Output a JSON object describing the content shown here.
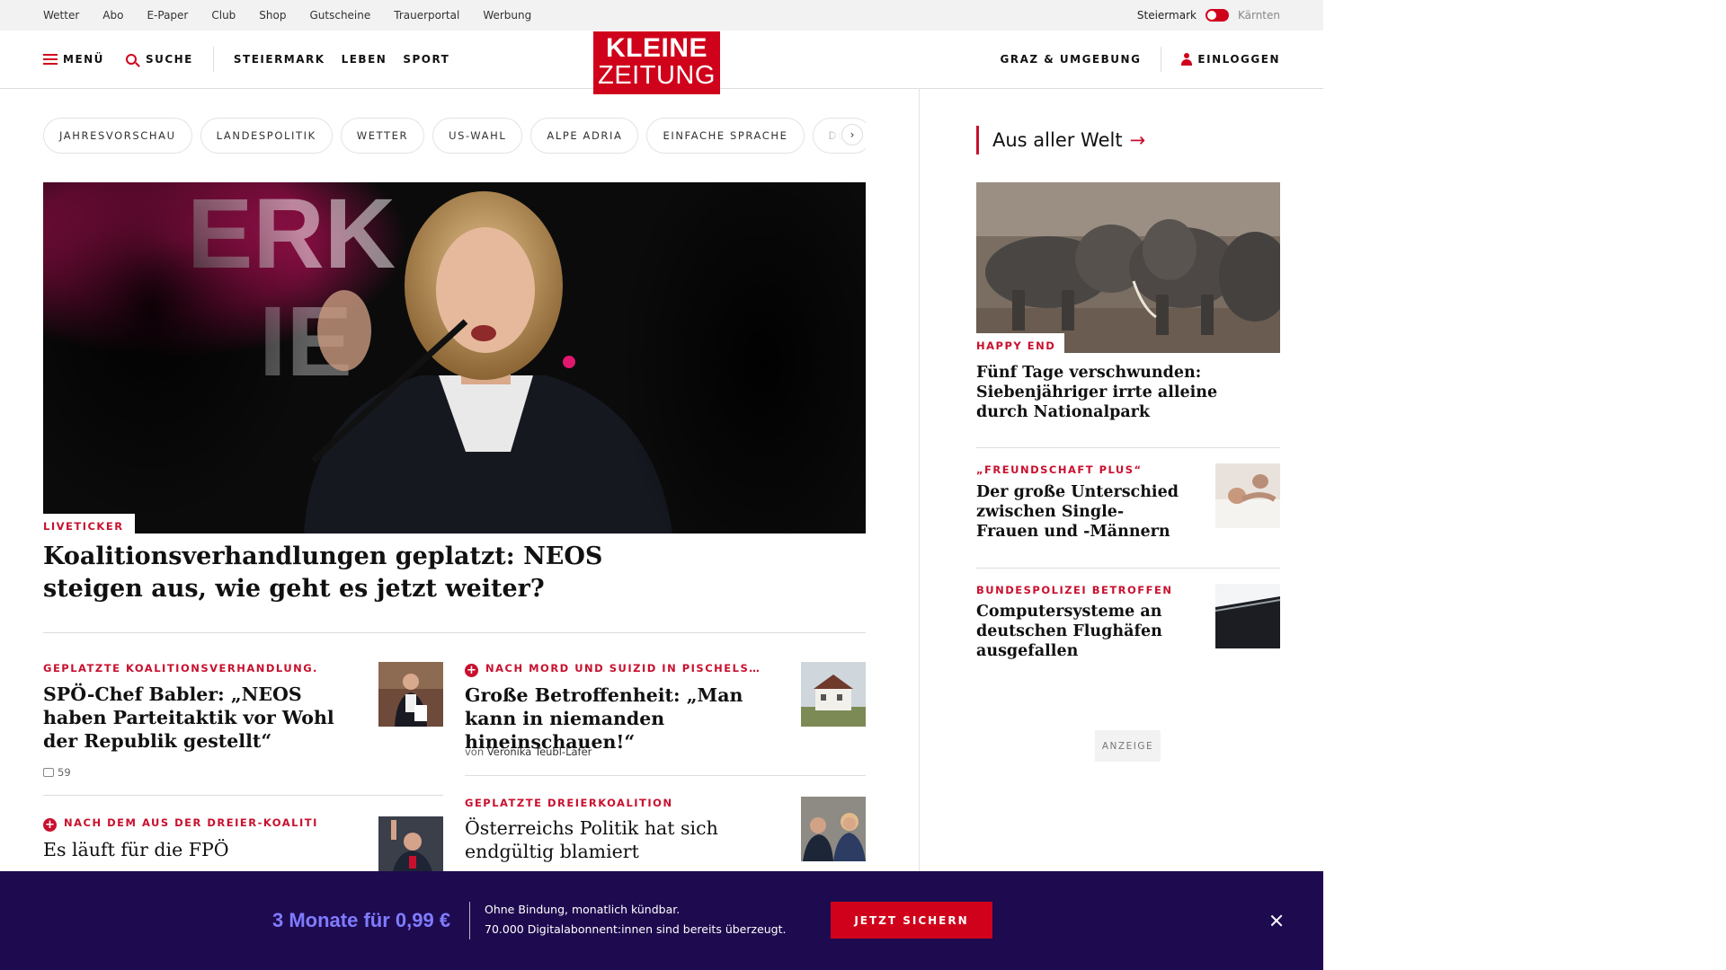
{
  "utility_bar": {
    "links": [
      "Wetter",
      "Abo",
      "E-Paper",
      "Club",
      "Shop",
      "Gutscheine",
      "Trauerportal",
      "Werbung"
    ],
    "region_active": "Steiermark",
    "region_other": "Kärnten"
  },
  "header": {
    "menu_label": "MENÜ",
    "search_label": "SUCHE",
    "nav": [
      "STEIERMARK",
      "LEBEN",
      "SPORT"
    ],
    "logo_line1": "KLEINE",
    "logo_line2": "ZEITUNG",
    "region_link": "GRAZ & UMGEBUNG",
    "login_label": "EINLOGGEN",
    "brand_color": "#d0021b"
  },
  "topic_chips": [
    "JAHRESVORSCHAU",
    "LANDESPOLITIK",
    "WETTER",
    "US-WAHL",
    "ALPE ADRIA",
    "EINFACHE SPRACHE",
    "DOS"
  ],
  "hero": {
    "label": "LIVETICKER",
    "title": "Koalitionsverhandlungen geplatzt: NEOS steigen aus, wie geht es jetzt weiter?"
  },
  "articles": [
    {
      "kicker": "GEPLATZTE KOALITIONSVERHANDLUNG…",
      "title": "SPÖ-Chef Babler: „NEOS haben Parteitaktik vor Wohl der Republik gestellt“",
      "comments": "59"
    },
    {
      "kicker": "NACH MORD UND SUIZID IN PISCHELS…",
      "title": "Große Betroffenheit: „Man kann in niemanden hineinschauen!“",
      "author_prefix": "von",
      "author": "Veronika Teubl-Lafer"
    },
    {
      "kicker": "NACH DEM AUS DER DREIER-KOALITI…",
      "title": "Es läuft für die FPÖ"
    },
    {
      "kicker": "GEPLATZTE DREIERKOALITION",
      "title": "Österreichs Politik hat sich endgültig blamiert"
    }
  ],
  "sidebar": {
    "title": "Aus aller Welt",
    "arrow": "→",
    "main": {
      "label": "HAPPY END",
      "title": "Fünf Tage verschwunden: Siebenjähriger irrte alleine durch Nationalpark"
    },
    "items": [
      {
        "kicker": "„FREUNDSCHAFT PLUS“",
        "title": "Der große Unterschied zwischen Single-Frauen und -Männern"
      },
      {
        "kicker": "BUNDESPOLIZEI BETROFFEN",
        "title": "Computersysteme an deutschen Flughäfen ausgefallen"
      }
    ],
    "ad_label": "ANZEIGE"
  },
  "banner": {
    "price": "3 Monate für 0,99 €",
    "line1": "Ohne Bindung, monatlich kündbar.",
    "line2": "70.000 Digitalabonnent:innen sind bereits überzeugt.",
    "button": "JETZT SICHERN",
    "bg_color": "#1e0a4f"
  }
}
